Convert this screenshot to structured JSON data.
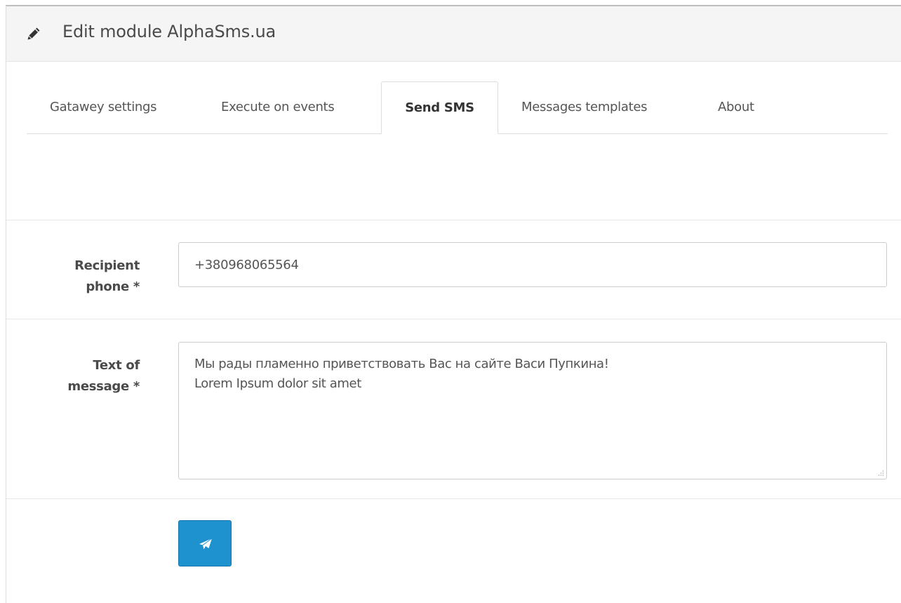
{
  "header": {
    "icon": "pencil-icon",
    "title": "Edit module AlphaSms.ua"
  },
  "tabs": [
    {
      "label": "Gatawey settings",
      "active": false
    },
    {
      "label": "Execute on events",
      "active": false
    },
    {
      "label": "Send SMS",
      "active": true
    },
    {
      "label": "Messages templates",
      "active": false
    },
    {
      "label": "About",
      "active": false
    }
  ],
  "form": {
    "recipient_label_line1": "Recipient",
    "recipient_label_line2": "phone *",
    "recipient_value": "+380968065564",
    "message_label_line1": "Text of",
    "message_label_line2": "message *",
    "message_lines": [
      "Мы рады пламенно приветствовать Вас на сайте Васи Пупкина!",
      "Lorem Ipsum dolor sit amet"
    ],
    "send_button_icon": "paper-plane-icon"
  },
  "colors": {
    "accent": "#1e91cf",
    "heading_bg": "#f5f5f5"
  }
}
